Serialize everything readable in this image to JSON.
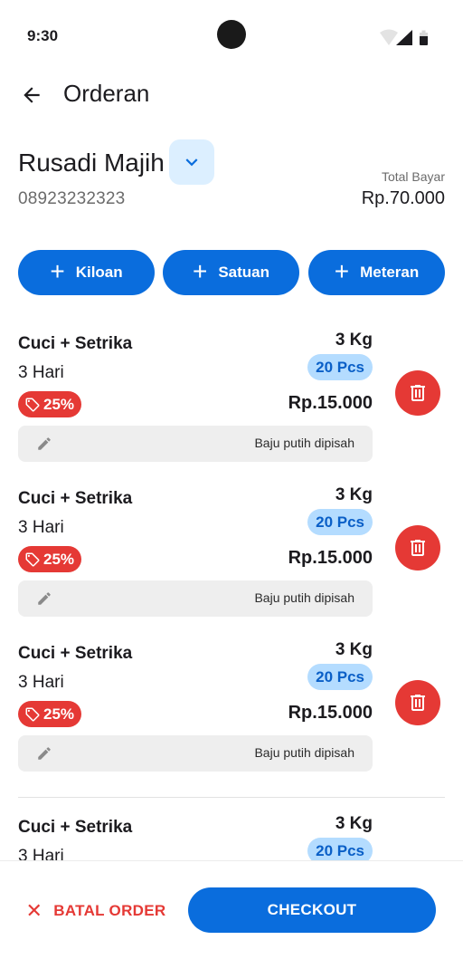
{
  "status_bar": {
    "time": "9:30",
    "icons": [
      "wifi-icon",
      "cellular-signal-icon",
      "battery-icon"
    ]
  },
  "app_bar": {
    "title": "Orderan",
    "back_icon": "arrow-back-icon"
  },
  "customer": {
    "name": "Rusadi Majih",
    "phone": "08923232323",
    "toggle_icon": "chevron-down-icon",
    "total_label": "Total Bayar",
    "total_value": "Rp.70.000"
  },
  "type_buttons": [
    {
      "label": "Kiloan",
      "icon": "plus-icon"
    },
    {
      "label": "Satuan",
      "icon": "plus-icon"
    },
    {
      "label": "Meteran",
      "icon": "plus-icon"
    }
  ],
  "items": [
    {
      "service": "Cuci + Setrika",
      "duration": "3 Hari",
      "weight": "3 Kg",
      "pcs": "20 Pcs",
      "discount": "25%",
      "price": "Rp.15.000",
      "note": "Baju putih dipisah"
    },
    {
      "service": "Cuci + Setrika",
      "duration": "3 Hari",
      "weight": "3 Kg",
      "pcs": "20 Pcs",
      "discount": "25%",
      "price": "Rp.15.000",
      "note": "Baju putih dipisah"
    },
    {
      "service": "Cuci + Setrika",
      "duration": "3 Hari",
      "weight": "3 Kg",
      "pcs": "20 Pcs",
      "discount": "25%",
      "price": "Rp.15.000",
      "note": "Baju putih dipisah"
    },
    {
      "service": "Cuci + Setrika",
      "duration": "3 Hari",
      "weight": "3 Kg",
      "pcs": "20 Pcs"
    }
  ],
  "footer": {
    "cancel_label": "BATAL ORDER",
    "checkout_label": "CHECKOUT"
  },
  "colors": {
    "primary": "#0a6ddd",
    "danger": "#e53935",
    "pcs_badge_bg": "#b4dcff",
    "note_bg": "#eeeeee"
  }
}
